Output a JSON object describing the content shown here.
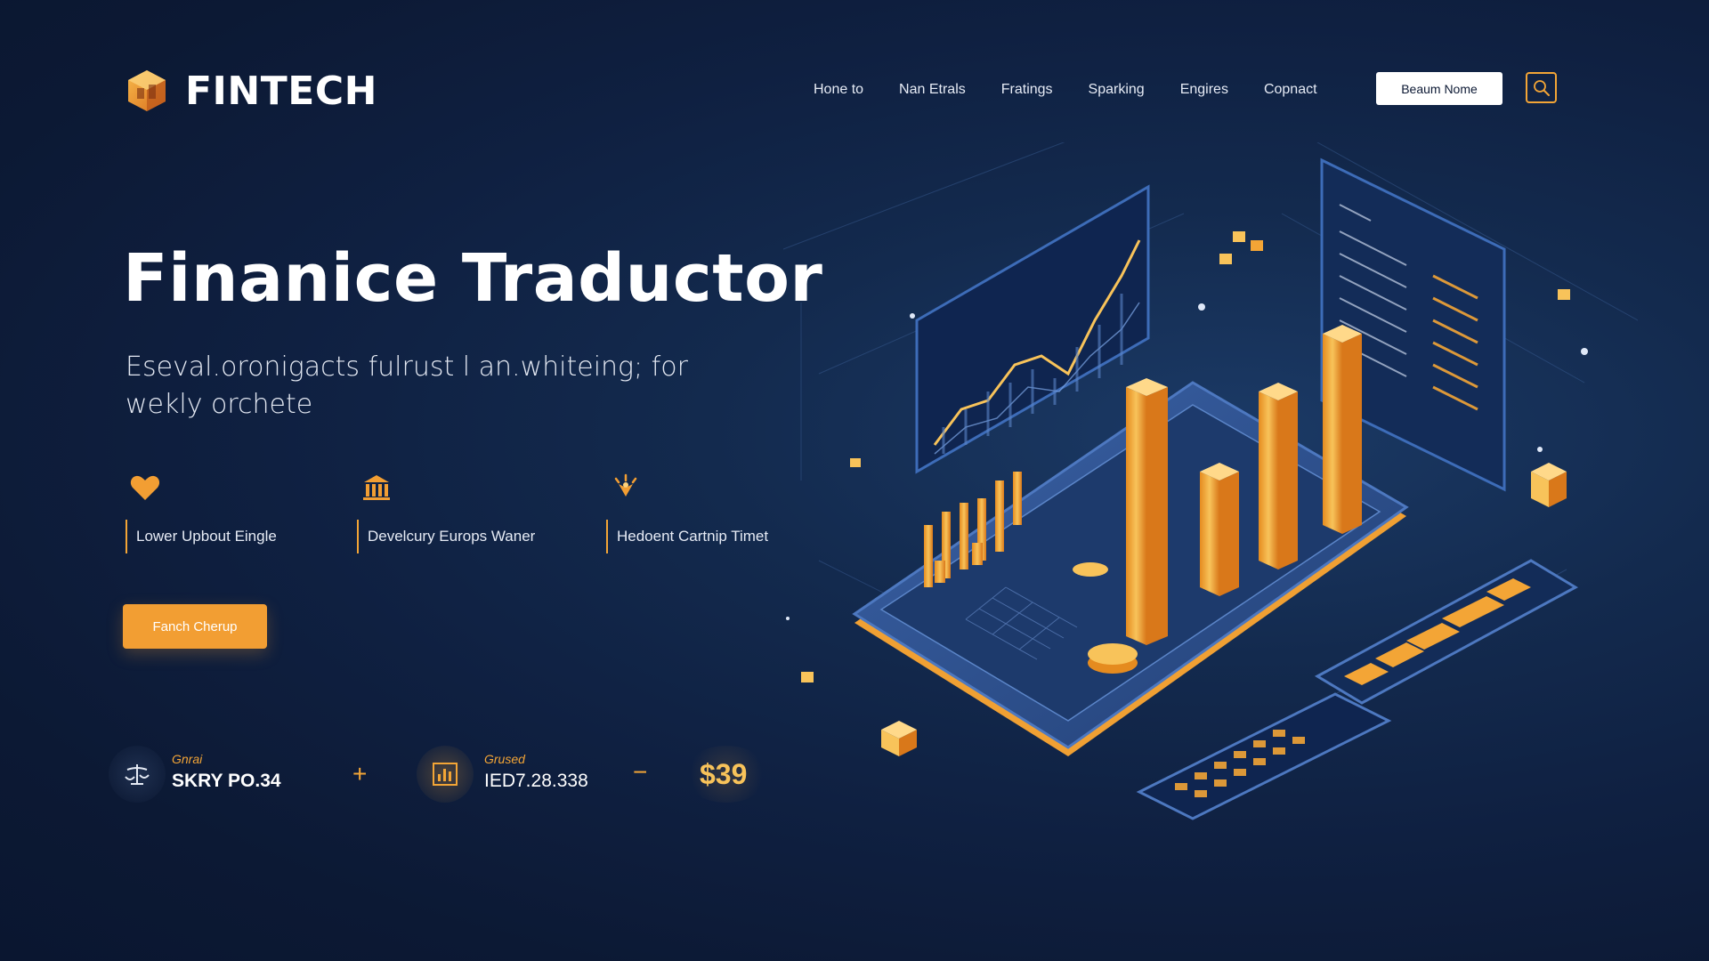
{
  "brand": {
    "name": "FINTECH",
    "logo_icon": "hexagon-logo-icon",
    "accent": "#f3a536"
  },
  "nav": {
    "items": [
      "Hone to",
      "Nan Etrals",
      "Fratings",
      "Sparking",
      "Engires",
      "Copnact"
    ],
    "cta_label": "Beaum Nome",
    "search_icon": "search-icon"
  },
  "hero": {
    "title": "Finanice Traductor",
    "subtitle": "Eseval.oronigacts fulrust l an.whiteing; for wekly orchete"
  },
  "features": [
    {
      "icon": "heart-icon",
      "label": "Lower Upbout Eingle"
    },
    {
      "icon": "bank-icon",
      "label": "Develcury Europs Waner"
    },
    {
      "icon": "sparkle-icon",
      "label": "Hedoent Cartnip Timet"
    }
  ],
  "primary_button": {
    "label": "Fanch Cherup",
    "color": "#f29e33"
  },
  "stats": [
    {
      "icon": "scale-icon",
      "caption": "Gnrai",
      "value": "SKRY PO.34"
    },
    {
      "separator": "+"
    },
    {
      "icon": "chart-box-icon",
      "caption": "Grused",
      "value": "IED7.28.338"
    },
    {
      "separator": "−"
    },
    {
      "price": "$39"
    }
  ],
  "colors": {
    "background": "#0f2041",
    "accent": "#f3a536",
    "gold": "#f8c35a"
  }
}
